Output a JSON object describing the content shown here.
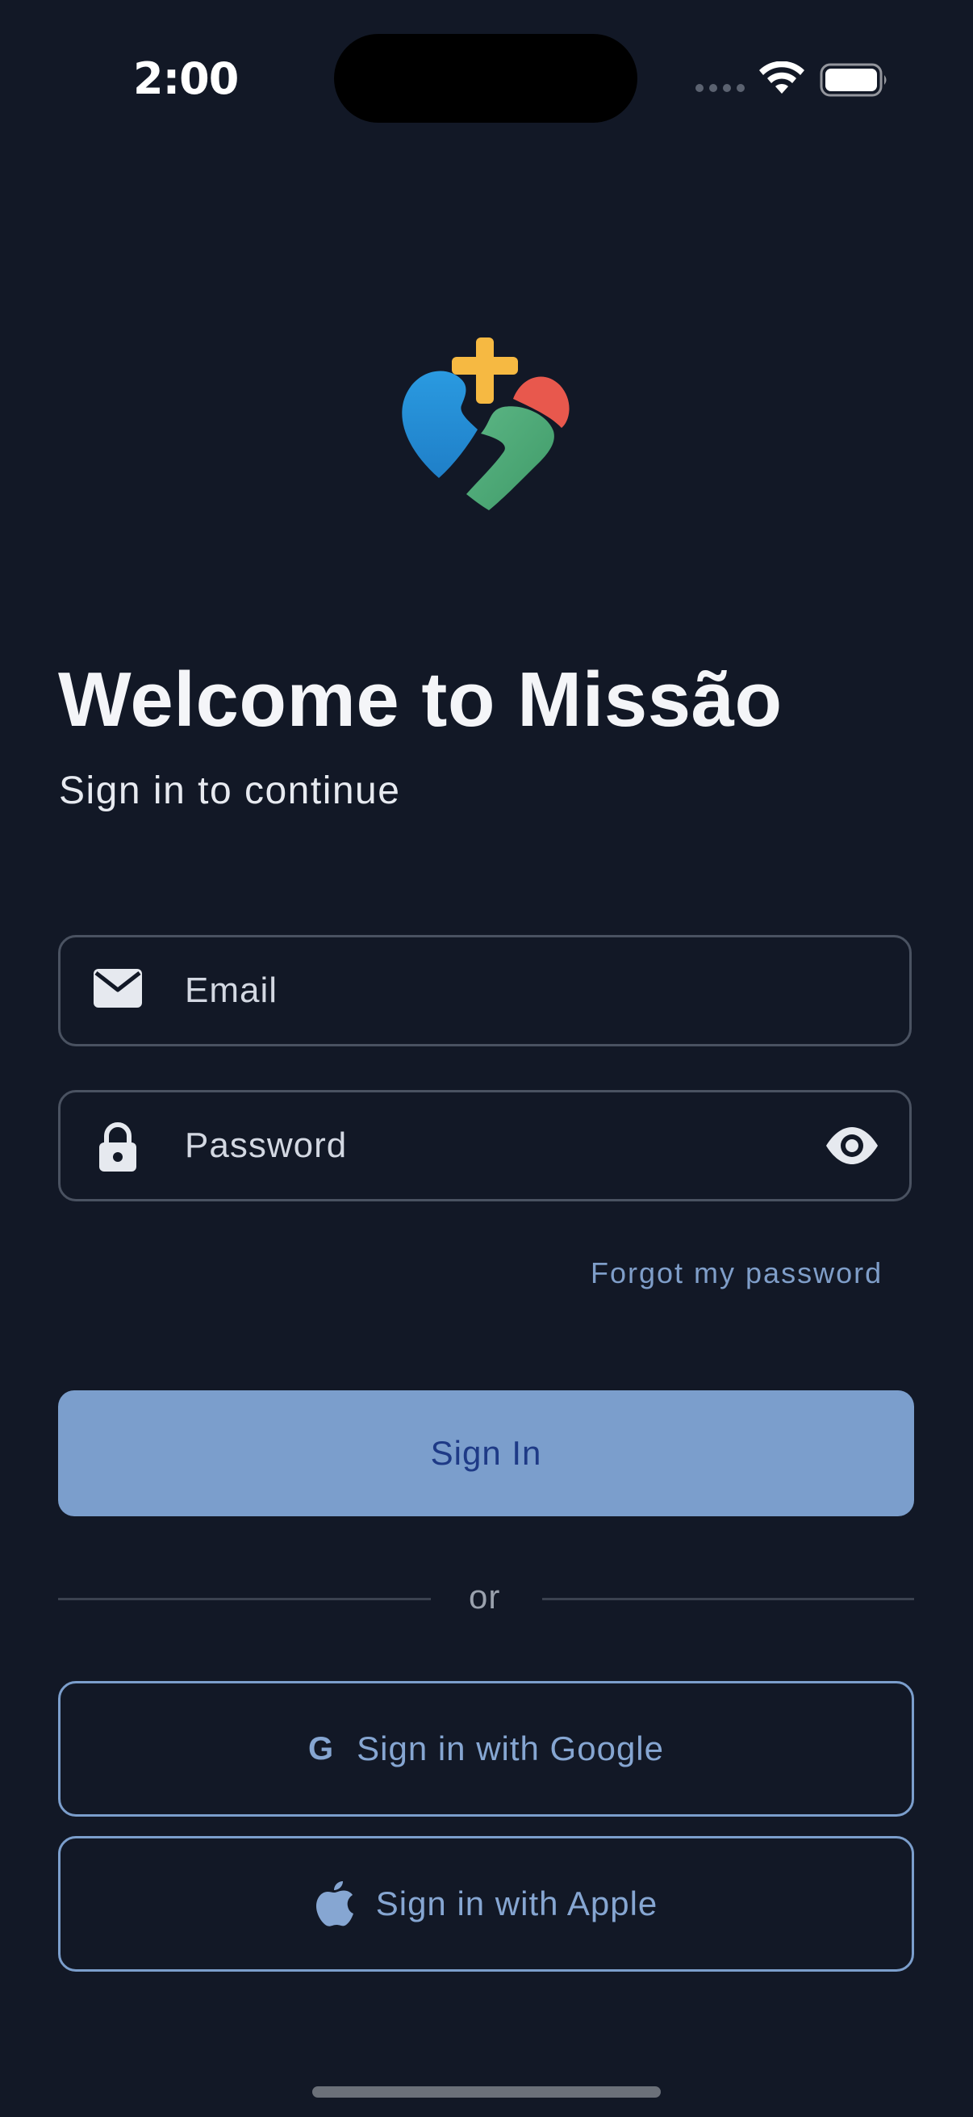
{
  "status_bar": {
    "time": "2:00"
  },
  "header": {
    "title": "Welcome to Missão",
    "subtitle": "Sign in to continue"
  },
  "form": {
    "email": {
      "placeholder": "Email",
      "value": "",
      "icon": "mail-icon"
    },
    "password": {
      "placeholder": "Password",
      "value": "",
      "icon": "lock-icon",
      "toggle_icon": "eye-icon"
    },
    "forgot_label": "Forgot my password",
    "submit_label": "Sign In"
  },
  "divider": {
    "label": "or"
  },
  "social": {
    "google_label": "Sign in with Google",
    "google_icon_glyph": "G",
    "apple_label": "Sign in with Apple"
  },
  "colors": {
    "background": "#121826",
    "primary": "#7b9ecc",
    "primary_text": "#1e3a86",
    "link": "#7f9ec9",
    "logo_blue": "#2490d9",
    "logo_red": "#e8584d",
    "logo_green": "#4fa876",
    "logo_yellow": "#f6b942"
  }
}
